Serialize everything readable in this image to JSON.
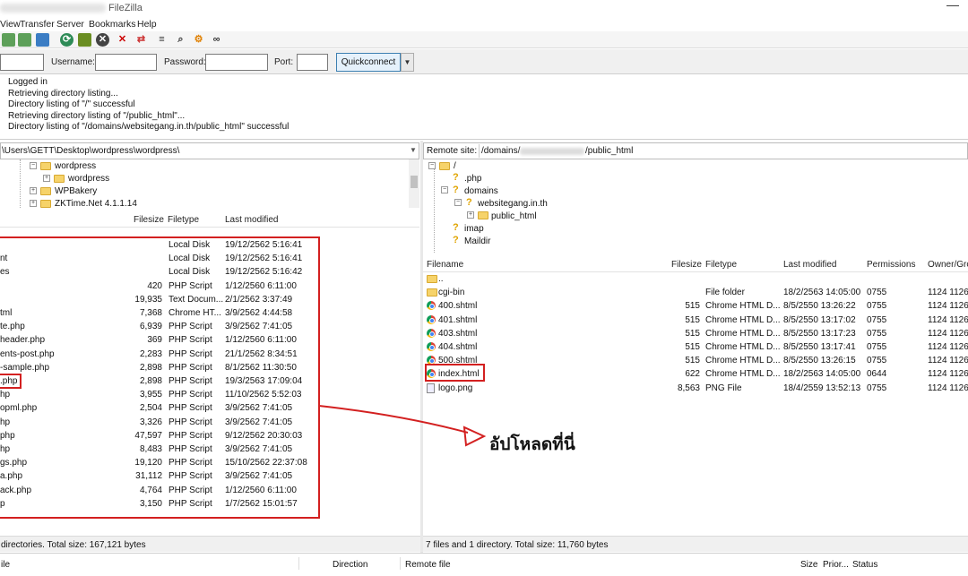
{
  "window": {
    "title": "FileZilla"
  },
  "menu": [
    "View",
    "Transfer",
    "Server",
    "Bookmarks",
    "Help"
  ],
  "quickconnect": {
    "username_label": "Username:",
    "password_label": "Password:",
    "port_label": "Port:",
    "button": "Quickconnect",
    "dropdown": "▼"
  },
  "log": [
    "Logged in",
    "Retrieving directory listing...",
    "Directory listing of \"/\" successful",
    "Retrieving directory listing of \"/public_html\"...",
    "Directory listing of \"/domains/websitegang.in.th/public_html\" successful"
  ],
  "local": {
    "path": "\\Users\\GETT\\Desktop\\wordpress\\wordpress\\",
    "tree": [
      "wordpress",
      "wordpress",
      "WPBakery",
      "ZKTime.Net 4.1.1.14"
    ],
    "columns": {
      "filesize": "Filesize",
      "filetype": "Filetype",
      "modified": "Last modified"
    },
    "files": [
      {
        "name": "",
        "size": "",
        "type": "Local Disk",
        "date": "19/12/2562 5:16:41"
      },
      {
        "name": "nt",
        "size": "",
        "type": "Local Disk",
        "date": "19/12/2562 5:16:41"
      },
      {
        "name": "es",
        "size": "",
        "type": "Local Disk",
        "date": "19/12/2562 5:16:42"
      },
      {
        "name": "",
        "size": "420",
        "type": "PHP Script",
        "date": "1/12/2560 6:11:00"
      },
      {
        "name": "",
        "size": "19,935",
        "type": "Text Docum...",
        "date": "2/1/2562 3:37:49"
      },
      {
        "name": "tml",
        "size": "7,368",
        "type": "Chrome HT...",
        "date": "3/9/2562 4:44:58"
      },
      {
        "name": "te.php",
        "size": "6,939",
        "type": "PHP Script",
        "date": "3/9/2562 7:41:05"
      },
      {
        "name": "header.php",
        "size": "369",
        "type": "PHP Script",
        "date": "1/12/2560 6:11:00"
      },
      {
        "name": "ents-post.php",
        "size": "2,283",
        "type": "PHP Script",
        "date": "21/1/2562 8:34:51"
      },
      {
        "name": "-sample.php",
        "size": "2,898",
        "type": "PHP Script",
        "date": "8/1/2562 11:30:50"
      },
      {
        "name": ".php",
        "size": "2,898",
        "type": "PHP Script",
        "date": "19/3/2563 17:09:04"
      },
      {
        "name": "hp",
        "size": "3,955",
        "type": "PHP Script",
        "date": "11/10/2562 5:52:03"
      },
      {
        "name": "opml.php",
        "size": "2,504",
        "type": "PHP Script",
        "date": "3/9/2562 7:41:05"
      },
      {
        "name": "hp",
        "size": "3,326",
        "type": "PHP Script",
        "date": "3/9/2562 7:41:05"
      },
      {
        "name": "php",
        "size": "47,597",
        "type": "PHP Script",
        "date": "9/12/2562 20:30:03"
      },
      {
        "name": "hp",
        "size": "8,483",
        "type": "PHP Script",
        "date": "3/9/2562 7:41:05"
      },
      {
        "name": "gs.php",
        "size": "19,120",
        "type": "PHP Script",
        "date": "15/10/2562 22:37:08"
      },
      {
        "name": "a.php",
        "size": "31,112",
        "type": "PHP Script",
        "date": "3/9/2562 7:41:05"
      },
      {
        "name": "ack.php",
        "size": "4,764",
        "type": "PHP Script",
        "date": "1/12/2560 6:11:00"
      },
      {
        "name": "p",
        "size": "3,150",
        "type": "PHP Script",
        "date": "1/7/2562 15:01:57"
      }
    ],
    "status": "directories. Total size: 167,121 bytes"
  },
  "remote": {
    "site_label": "Remote site:",
    "path_prefix": "/domains/",
    "path_suffix": "/public_html",
    "tree": [
      "/",
      ".php",
      "domains",
      "websitegang.in.th",
      "public_html",
      "imap",
      "Maildir"
    ],
    "columns": {
      "filename": "Filename",
      "filesize": "Filesize",
      "filetype": "Filetype",
      "modified": "Last modified",
      "permissions": "Permissions",
      "owner": "Owner/Gro"
    },
    "files": [
      {
        "name": "..",
        "size": "",
        "type": "",
        "date": "",
        "perm": "",
        "owner": "",
        "icon": "folder"
      },
      {
        "name": "cgi-bin",
        "size": "",
        "type": "File folder",
        "date": "18/2/2563 14:05:00",
        "perm": "0755",
        "owner": "1124 1126",
        "icon": "folder"
      },
      {
        "name": "400.shtml",
        "size": "515",
        "type": "Chrome HTML D...",
        "date": "8/5/2550 13:26:22",
        "perm": "0755",
        "owner": "1124 1126",
        "icon": "chrome"
      },
      {
        "name": "401.shtml",
        "size": "515",
        "type": "Chrome HTML D...",
        "date": "8/5/2550 13:17:02",
        "perm": "0755",
        "owner": "1124 1126",
        "icon": "chrome"
      },
      {
        "name": "403.shtml",
        "size": "515",
        "type": "Chrome HTML D...",
        "date": "8/5/2550 13:17:23",
        "perm": "0755",
        "owner": "1124 1126",
        "icon": "chrome"
      },
      {
        "name": "404.shtml",
        "size": "515",
        "type": "Chrome HTML D...",
        "date": "8/5/2550 13:17:41",
        "perm": "0755",
        "owner": "1124 1126",
        "icon": "chrome"
      },
      {
        "name": "500.shtml",
        "size": "515",
        "type": "Chrome HTML D...",
        "date": "8/5/2550 13:26:15",
        "perm": "0755",
        "owner": "1124 1126",
        "icon": "chrome"
      },
      {
        "name": "index.html",
        "size": "622",
        "type": "Chrome HTML D...",
        "date": "18/2/2563 14:05:00",
        "perm": "0644",
        "owner": "1124 1126",
        "icon": "chrome"
      },
      {
        "name": "logo.png",
        "size": "8,563",
        "type": "PNG File",
        "date": "18/4/2559 13:52:13",
        "perm": "0755",
        "owner": "1124 1126",
        "icon": "png"
      }
    ],
    "status": "7 files and 1 directory. Total size: 11,760 bytes"
  },
  "annotation": {
    "text": "อัปโหลดที่นี่",
    "color": "#d32020"
  },
  "queue": {
    "local_file": "ile",
    "direction": "Direction",
    "remote_file": "Remote file",
    "size": "Size",
    "priority": "Prior...",
    "status": "Status"
  }
}
